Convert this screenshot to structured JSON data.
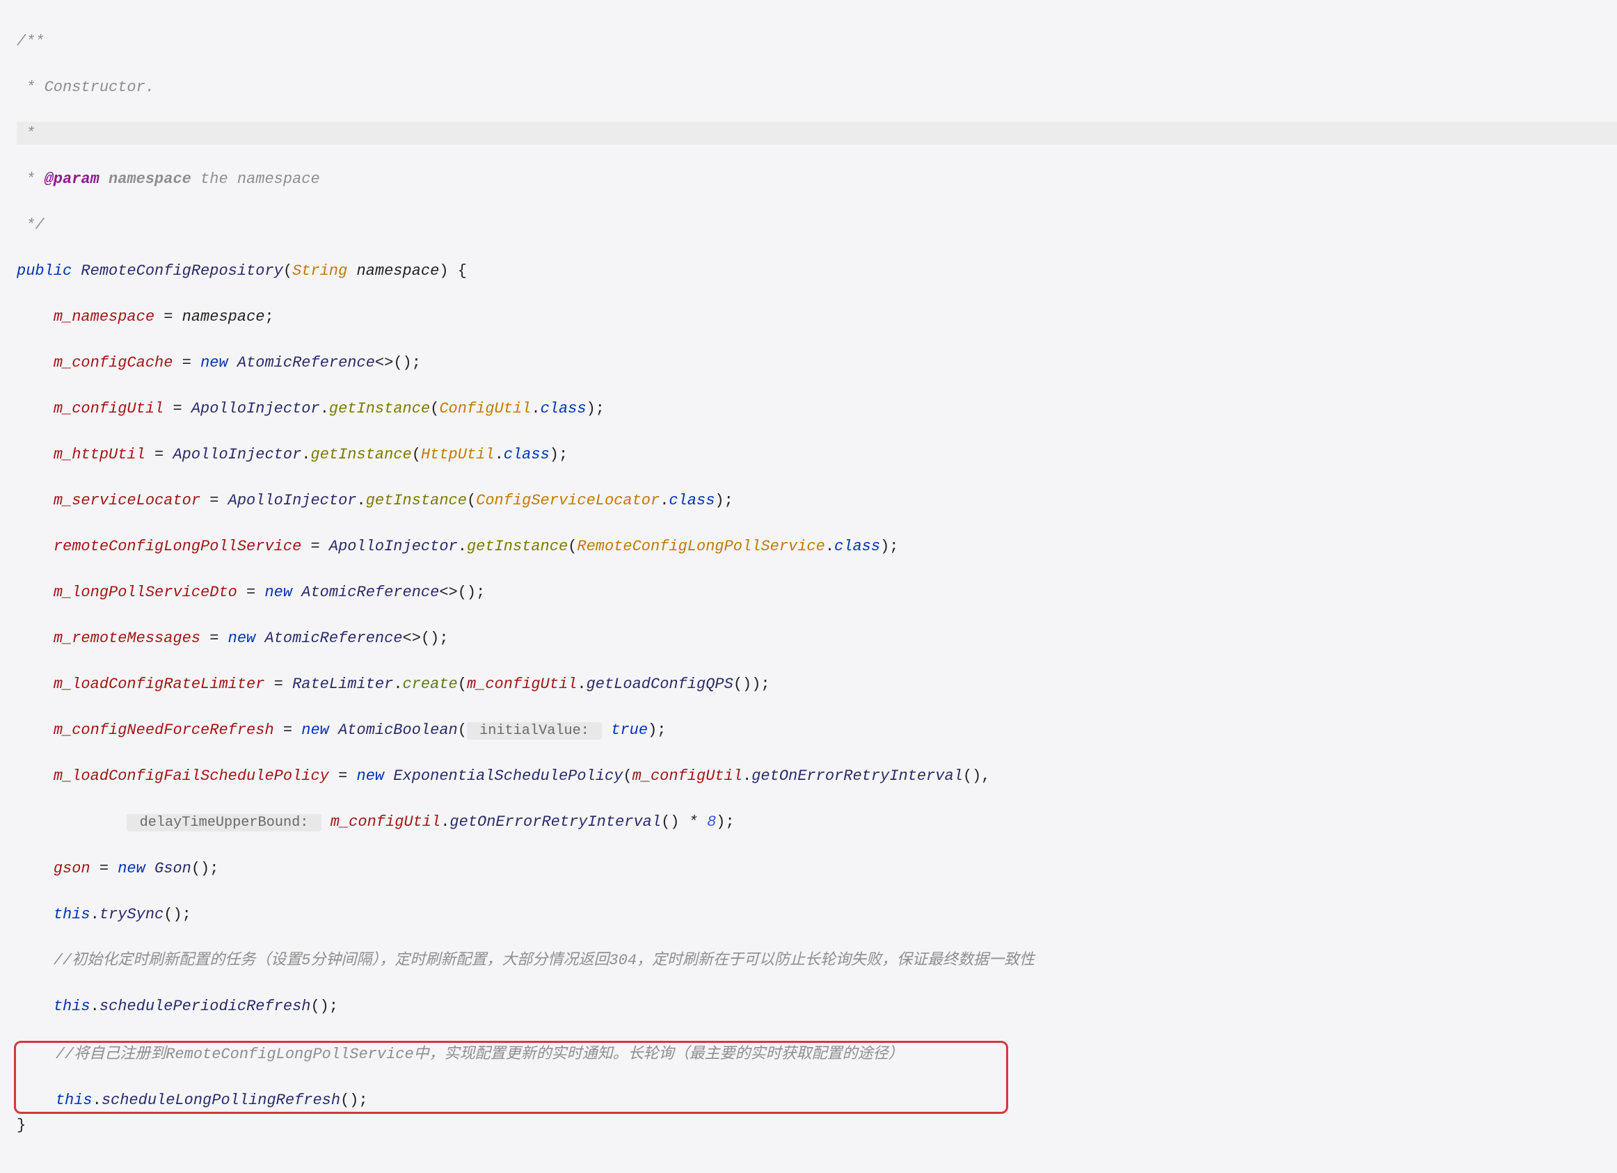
{
  "doc": {
    "open": "/**",
    "line1": " * Constructor.",
    "line2": " *",
    "param_tag": "@param",
    "param_name": "namespace",
    "param_desc": " the namespace",
    "close": " */"
  },
  "sig": {
    "public": "public",
    "ctor": "RemoteConfigRepository",
    "ptype": "String",
    "pname": "namespace"
  },
  "body": {
    "l1": {
      "field": "m_namespace",
      "op": " = ",
      "rhs": "namespace",
      "end": ";"
    },
    "l2": {
      "field": "m_configCache",
      "op": " = ",
      "new": "new",
      "type": "AtomicReference",
      "gen": "<>",
      "call": "()",
      "end": ";"
    },
    "l3": {
      "field": "m_configUtil",
      "op": " = ",
      "type": "ApolloInjector",
      "dot": ".",
      "method": "getInstance",
      "args_open": "(",
      "arg_type": "ConfigUtil",
      "dot2": ".",
      "class": "class",
      "args_close": ")",
      "end": ";"
    },
    "l4": {
      "field": "m_httpUtil",
      "op": " = ",
      "type": "ApolloInjector",
      "dot": ".",
      "method": "getInstance",
      "args_open": "(",
      "arg_type": "HttpUtil",
      "dot2": ".",
      "class": "class",
      "args_close": ")",
      "end": ";"
    },
    "l5": {
      "field": "m_serviceLocator",
      "op": " = ",
      "type": "ApolloInjector",
      "dot": ".",
      "method": "getInstance",
      "args_open": "(",
      "arg_type": "ConfigServiceLocator",
      "dot2": ".",
      "class": "class",
      "args_close": ")",
      "end": ";"
    },
    "l6": {
      "field": "remoteConfigLongPollService",
      "op": " = ",
      "type": "ApolloInjector",
      "dot": ".",
      "method": "getInstance",
      "args_open": "(",
      "arg_type": "RemoteConfigLongPollService",
      "dot2": ".",
      "class": "class",
      "args_close": ")",
      "end": ";"
    },
    "l7": {
      "field": "m_longPollServiceDto",
      "op": " = ",
      "new": "new",
      "type": "AtomicReference",
      "gen": "<>",
      "call": "()",
      "end": ";"
    },
    "l8": {
      "field": "m_remoteMessages",
      "op": " = ",
      "new": "new",
      "type": "AtomicReference",
      "gen": "<>",
      "call": "()",
      "end": ";"
    },
    "l9": {
      "field": "m_loadConfigRateLimiter",
      "op": " = ",
      "type": "RateLimiter",
      "dot": ".",
      "method": "create",
      "args_open": "(",
      "inner_field": "m_configUtil",
      "dot2": ".",
      "inner_method": "getLoadConfigQPS",
      "inner_call": "()",
      "args_close": ")",
      "end": ";"
    },
    "l10": {
      "field": "m_configNeedForceRefresh",
      "op": " = ",
      "new": "new",
      "type": "AtomicBoolean",
      "args_open": "(",
      "hint": " initialValue: ",
      "val": "true",
      "args_close": ")",
      "end": ";"
    },
    "l11a": {
      "field": "m_loadConfigFailSchedulePolicy",
      "op": " = ",
      "new": "new",
      "type": "ExponentialSchedulePolicy",
      "args_open": "(",
      "inner_field": "m_configUtil",
      "dot": ".",
      "inner_method": "getOnErrorRetryInterval",
      "call": "()",
      "comma": ","
    },
    "l11b": {
      "hint": " delayTimeUpperBound: ",
      "inner_field": "m_configUtil",
      "dot": ".",
      "inner_method": "getOnErrorRetryInterval",
      "call": "()",
      "mul": " * ",
      "num": "8",
      "args_close": ")",
      "end": ";"
    },
    "l12": {
      "field": "gson",
      "op": " = ",
      "new": "new",
      "type": "Gson",
      "call": "()",
      "end": ";"
    },
    "l13": {
      "this": "this",
      "dot": ".",
      "method": "trySync",
      "call": "()",
      "end": ";"
    },
    "l14": {
      "comment": "//初始化定时刷新配置的任务（设置5分钟间隔），定时刷新配置，大部分情况返回304，定时刷新在于可以防止长轮询失败，保证最终数据一致性"
    },
    "l15": {
      "this": "this",
      "dot": ".",
      "method": "schedulePeriodicRefresh",
      "call": "()",
      "end": ";"
    },
    "l16": {
      "comment": "//将自己注册到RemoteConfigLongPollService中，实现配置更新的实时通知。长轮询（最主要的实时获取配置的途径）"
    },
    "l17": {
      "this": "this",
      "dot": ".",
      "method": "scheduleLongPollingRefresh",
      "call": "()",
      "end": ";"
    }
  },
  "close_brace": "}"
}
